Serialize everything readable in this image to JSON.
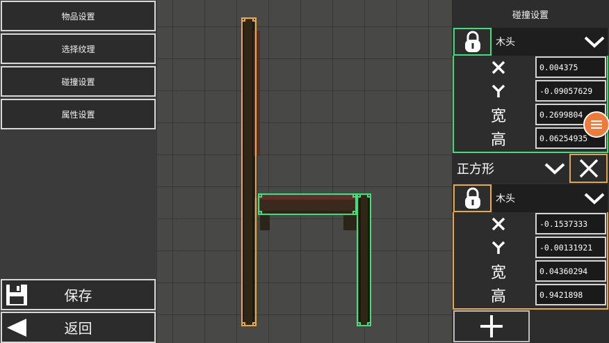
{
  "menu": {
    "items": [
      {
        "label": "物品设置"
      },
      {
        "label": "选择纹理"
      },
      {
        "label": "碰撞设置"
      },
      {
        "label": "属性设置"
      }
    ],
    "save_label": "保存",
    "back_label": "返回"
  },
  "panel": {
    "title": "碰撞设置",
    "colliders": [
      {
        "material": "木头",
        "x": "0.004375",
        "y": "-0.09057629",
        "width": "0.2699804",
        "height": "0.06254935",
        "labels": {
          "width": "宽",
          "height": "高"
        }
      },
      {
        "shape": "正方形",
        "material": "木头",
        "x": "-0.1537333",
        "y": "-0.00131921",
        "width": "0.04360294",
        "height": "0.9421898",
        "labels": {
          "width": "宽",
          "height": "高"
        }
      }
    ]
  },
  "colors": {
    "selected_collider": "#3fe07a",
    "other_collider": "#e8ab3c",
    "accent_button": "#f07a3a"
  }
}
